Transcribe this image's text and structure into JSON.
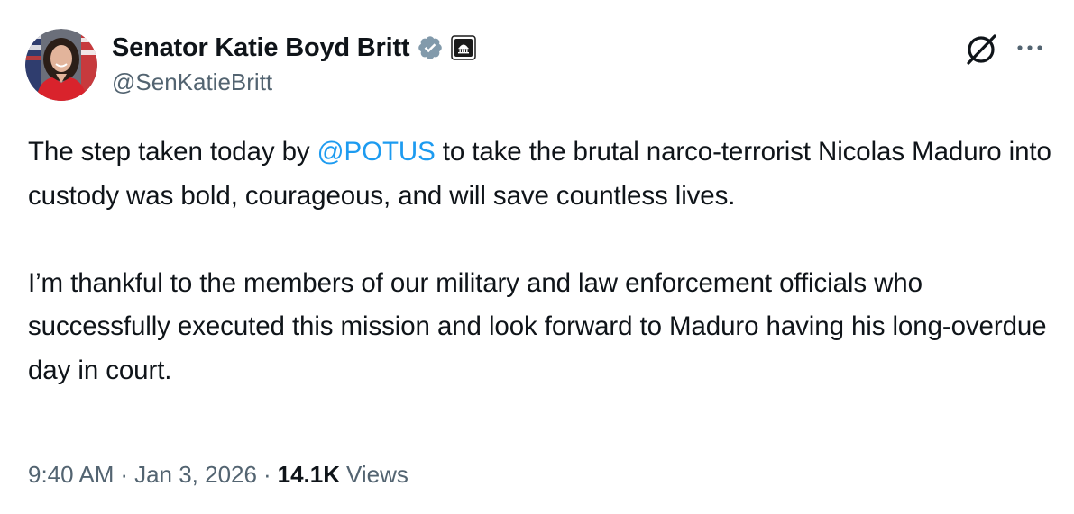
{
  "author": {
    "display_name": "Senator Katie Boyd Britt",
    "handle": "@SenKatieBritt",
    "verified_icon": "verified-check-icon",
    "affiliation_icon": "government-building-icon"
  },
  "actions": {
    "grok_icon": "grok-icon",
    "more_icon": "more-dots-icon"
  },
  "tweet": {
    "p1_before": "The step taken today by ",
    "p1_mention": "@POTUS",
    "p1_after": " to take the brutal narco-terrorist Nicolas Maduro into custody was bold, courageous, and will save countless lives.",
    "p2": "I’m thankful to the members of our military and law enforcement officials who successfully executed this mission and look forward to Maduro having his long-overdue day in court."
  },
  "meta": {
    "time": "9:40 AM",
    "date": "Jan 3, 2026",
    "separator": "·",
    "views_count": "14.1K",
    "views_label": "Views"
  },
  "colors": {
    "text": "#0f1419",
    "secondary": "#536471",
    "link": "#1d9bf0",
    "verified_badge": "#829aab"
  }
}
